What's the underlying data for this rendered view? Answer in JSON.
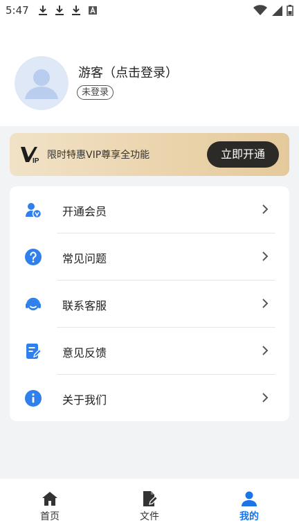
{
  "status_bar": {
    "time": "5:47",
    "left_icons": [
      "download-icon",
      "download-icon",
      "download-icon",
      "text-a-icon"
    ],
    "right_icons": [
      "wifi-icon",
      "signal-icon",
      "battery-icon"
    ]
  },
  "profile": {
    "name": "游客（点击登录）",
    "badge": "未登录",
    "avatar_icon": "user-avatar-icon"
  },
  "vip_banner": {
    "logo_icon": "vip-logo-icon",
    "text": "限时特惠VIP尊享全功能",
    "button_label": "立即开通"
  },
  "menu": {
    "items": [
      {
        "label": "开通会员",
        "icon": "member-vip-icon"
      },
      {
        "label": "常见问题",
        "icon": "question-icon"
      },
      {
        "label": "联系客服",
        "icon": "customer-service-icon"
      },
      {
        "label": "意见反馈",
        "icon": "feedback-icon"
      },
      {
        "label": "关于我们",
        "icon": "info-icon"
      }
    ]
  },
  "tab_bar": {
    "tabs": [
      {
        "label": "首页",
        "icon": "home-icon",
        "active": false
      },
      {
        "label": "文件",
        "icon": "file-edit-icon",
        "active": false
      },
      {
        "label": "我的",
        "icon": "profile-icon",
        "active": true
      }
    ]
  },
  "colors": {
    "accent": "#1b73e8",
    "icon_blue": "#2f80ed",
    "vip_button": "#2c2a26",
    "page_background": "#f2f3f5"
  }
}
